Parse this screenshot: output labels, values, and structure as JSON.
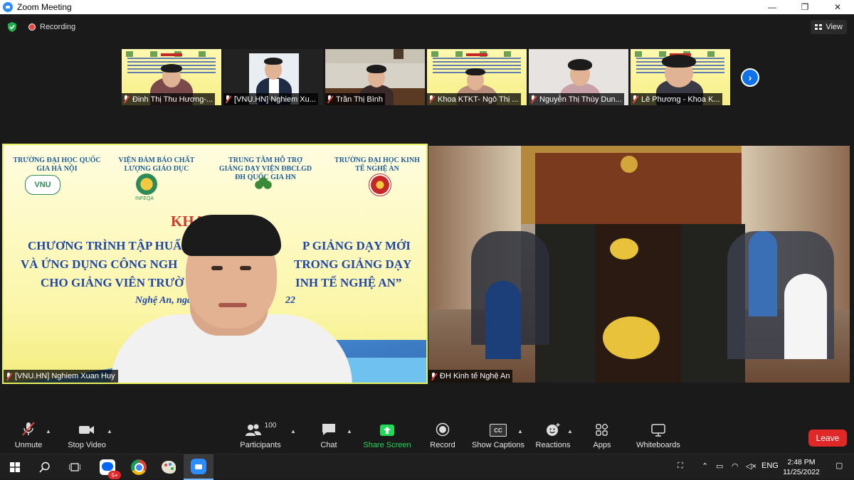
{
  "window": {
    "title": "Zoom Meeting",
    "minimize": "—",
    "maximize": "❐",
    "close": "✕"
  },
  "meeting": {
    "recording_label": "Recording",
    "view_label": "View",
    "accent": "#2d8cff",
    "recording_color": "#e8453c"
  },
  "thumbnails": [
    {
      "name": "Đinh Thị Thu Hương-..."
    },
    {
      "name": "[VNU.HN] Nghiem Xu..."
    },
    {
      "name": "Trần Thị Bình"
    },
    {
      "name": "Khoa KTKT- Ngô Thị ..."
    },
    {
      "name": "Nguyễn Thị Thùy Dun..."
    },
    {
      "name": "Lê Phương  - Khoa K..."
    }
  ],
  "main_videos": {
    "left_name": "[VNU.HN] Nghiem Xuan Huy",
    "right_name": "ĐH Kinh tế Nghệ An",
    "banner": {
      "org1": "TRƯỜNG ĐẠI HỌC QUỐC GIA HÀ NỘI",
      "org2": "VIỆN ĐẢM BẢO CHẤT LƯỢNG GIÁO DỤC",
      "org3": "TRUNG TÂM HỖ TRỢ GIẢNG DẠY VIỆN ĐBCLGD ĐH QUỐC GIA HN",
      "org4": "TRƯỜNG ĐẠI HỌC KINH TẾ NGHỆ AN",
      "logo_vnu": "VNU",
      "logo_infeqa": "INFEQA",
      "khai_mac": "KHAI M",
      "line1_left": "CHƯƠNG TRÌNH TẬP HUẤ",
      "line1_right": "P GIẢNG DẠY MỚI",
      "line2_left": "VÀ ỨNG DỤNG CÔNG NGH",
      "line2_right": "TRONG GIẢNG DẠY",
      "line3_left": "CHO GIẢNG VIÊN TRƯỜ",
      "line3_right": "INH TẾ NGHỆ AN”",
      "date_left": "Nghệ An, ngày",
      "date_right": "22"
    }
  },
  "toolbar": {
    "unmute": "Unmute",
    "stop_video": "Stop Video",
    "participants": "Participants",
    "participants_count": "100",
    "chat": "Chat",
    "share_screen": "Share Screen",
    "record": "Record",
    "show_captions": "Show Captions",
    "reactions": "Reactions",
    "apps": "Apps",
    "whiteboards": "Whiteboards",
    "leave": "Leave",
    "share_color": "#23d959",
    "leave_color": "#e02828",
    "cc": "CC"
  },
  "taskbar": {
    "zalo_badge": "5+",
    "language": "ENG",
    "time": "2:48 PM",
    "date": "11/25/2022"
  }
}
